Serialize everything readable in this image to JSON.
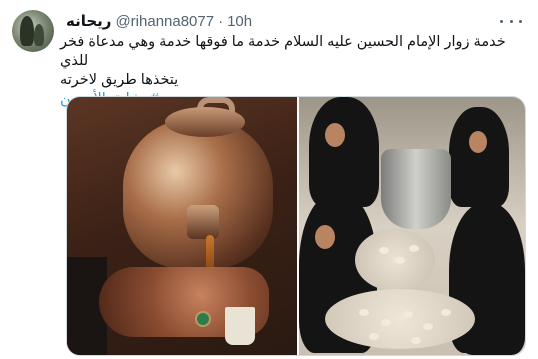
{
  "tweet": {
    "author_name": "ريحانه",
    "handle": "@rihanna8077",
    "separator": "·",
    "time": "10h",
    "text_lines": [
      "خدمة زوار الإمام الحسين عليه السلام خدمة ما فوقها خدمة وهي مدعاة فخر للذي",
      "يتخذها طريق لاخرته"
    ],
    "hashtag": "#مشاية_الأربعين"
  },
  "media": {
    "photos": [
      {
        "description_icon": "tea-pouring-photo"
      },
      {
        "description_icon": "bread-making-photo"
      }
    ]
  }
}
